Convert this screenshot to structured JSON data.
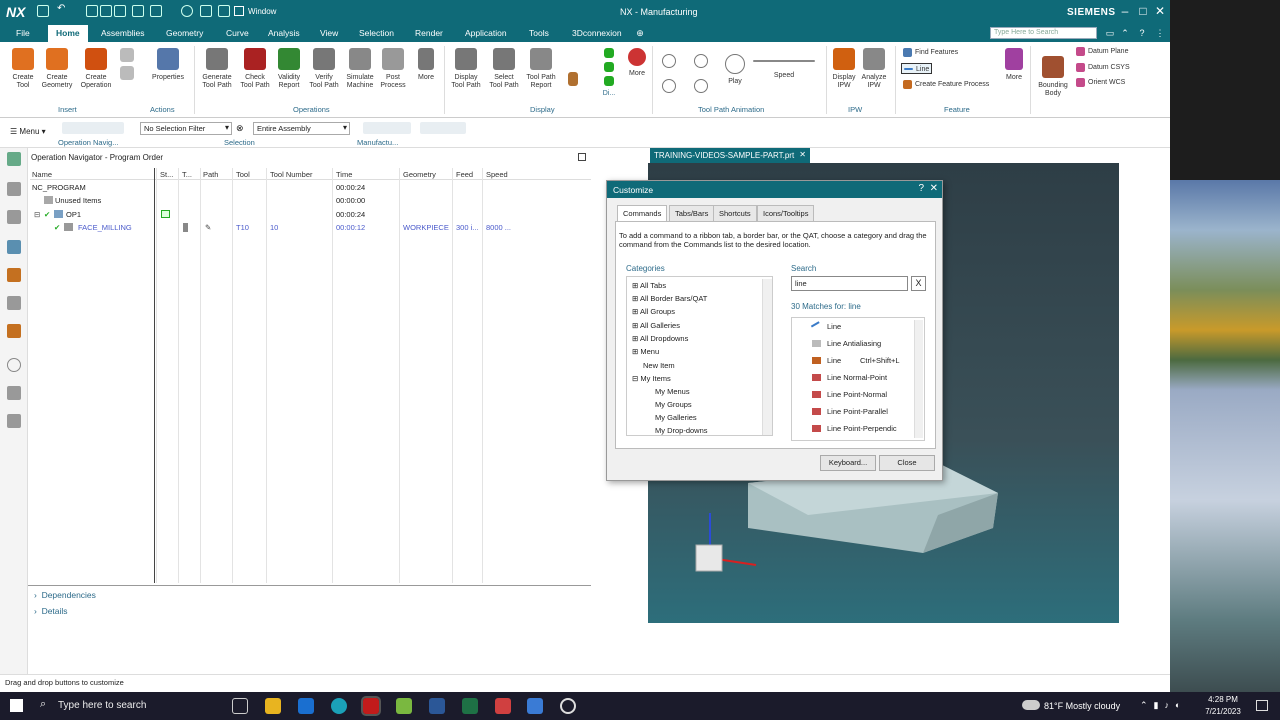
{
  "app": {
    "logo": "NX",
    "window_menu": "Window",
    "title": "NX - Manufacturing",
    "brand": "SIEMENS",
    "search_placeholder": "Type Here to Search"
  },
  "menu_tabs": [
    "File",
    "Home",
    "Assemblies",
    "Geometry",
    "Curve",
    "Analysis",
    "View",
    "Selection",
    "Render",
    "Application",
    "Tools",
    "3Dconnexion"
  ],
  "ribbon": {
    "buttons": [
      {
        "label": "Create\nTool",
        "icon": "create-tool-icon",
        "color": "#e07020"
      },
      {
        "label": "Create\nGeometry",
        "icon": "create-geometry-icon",
        "color": "#e07020"
      },
      {
        "label": "Create\nOperation",
        "icon": "create-operation-icon",
        "color": "#d05010"
      },
      {
        "label": "Properties",
        "icon": "properties-icon",
        "color": "#5577aa"
      },
      {
        "label": "Generate\nTool Path",
        "icon": "generate-tool-path-icon",
        "color": "#666"
      },
      {
        "label": "Check\nTool Path",
        "icon": "check-tool-path-icon",
        "color": "#aa2222"
      },
      {
        "label": "Validity\nReport",
        "icon": "validity-report-icon",
        "color": "#338833"
      },
      {
        "label": "Verify\nTool Path",
        "icon": "verify-tool-path-icon",
        "color": "#777"
      },
      {
        "label": "Simulate\nMachine",
        "icon": "simulate-machine-icon",
        "color": "#888"
      },
      {
        "label": "Post\nProcess",
        "icon": "post-process-icon",
        "color": "#999"
      },
      {
        "label": "More",
        "icon": "more-icon",
        "color": "#777"
      },
      {
        "label": "Display\nTool Path",
        "icon": "display-tool-path-icon",
        "color": "#777"
      },
      {
        "label": "Select\nTool Path",
        "icon": "select-tool-path-icon",
        "color": "#777"
      },
      {
        "label": "Tool Path\nReport",
        "icon": "tool-path-report-icon",
        "color": "#888"
      },
      {
        "label": "More",
        "icon": "more-icon",
        "color": "#777"
      },
      {
        "label": "Play",
        "icon": "play-icon",
        "color": "#777"
      },
      {
        "label": "Speed",
        "icon": "speed-slider-icon",
        "color": "#2a6"
      },
      {
        "label": "Display\nIPW",
        "icon": "display-ipw-icon",
        "color": "#d06010"
      },
      {
        "label": "Analyze\nIPW",
        "icon": "analyze-ipw-icon",
        "color": "#888"
      },
      {
        "label": "More",
        "icon": "more-icon",
        "color": "#a040a0"
      },
      {
        "label": "Bounding\nBody",
        "icon": "bounding-body-icon",
        "color": "#a05030"
      }
    ],
    "feature_rows": [
      "Find Features",
      "Line",
      "Create Feature Process"
    ],
    "datum_rows": [
      "Datum Plane",
      "Datum CSYS",
      "Orient WCS"
    ],
    "display_label": "Di...",
    "groups": [
      "Insert",
      "Actions",
      "Operations",
      "Display",
      "Tool Path Animation",
      "IPW",
      "Feature"
    ]
  },
  "secondary": {
    "menu": "Menu",
    "filter": "No Selection Filter",
    "scope": "Entire Assembly",
    "groups": [
      "Operation Navig...",
      "Selection",
      "Manufactu..."
    ]
  },
  "navigator": {
    "title": "Operation Navigator - Program Order",
    "columns": [
      "Name",
      "St...",
      "T...",
      "Path",
      "Tool",
      "Tool Number",
      "Time",
      "Geometry",
      "Feed",
      "Speed"
    ],
    "rows": [
      {
        "name": "NC_PROGRAM",
        "time": "00:00:24"
      },
      {
        "name": "Unused Items",
        "time": "00:00:00"
      },
      {
        "name": "OP1",
        "time": "00:00:24"
      },
      {
        "name": "FACE_MILLING",
        "tool": "T10",
        "tool_number": "10",
        "time": "00:00:12",
        "geometry": "WORKPIECE",
        "feed": "300 i...",
        "speed": "8000 ..."
      }
    ],
    "expanders": [
      "Dependencies",
      "Details"
    ]
  },
  "part_tab": "TRAINING-VIDEOS-SAMPLE-PART.prt",
  "dialog": {
    "title": "Customize",
    "tabs": [
      "Commands",
      "Tabs/Bars",
      "Shortcuts",
      "Icons/Tooltips"
    ],
    "instruction": "To add a command to a ribbon tab, a border bar, or the QAT, choose a category and drag the command from the Commands list to the desired location.",
    "categories_label": "Categories",
    "categories": [
      "All Tabs",
      "All Border Bars/QAT",
      "All Groups",
      "All Galleries",
      "All Dropdowns",
      "Menu",
      "New Item",
      "My Items",
      "My Menus",
      "My Groups",
      "My Galleries",
      "My Drop-downs"
    ],
    "search_label": "Search",
    "search_value": "line",
    "matches_label": "30 Matches for: line",
    "matches": [
      {
        "label": "Line",
        "shortcut": ""
      },
      {
        "label": "Line Antialiasing",
        "shortcut": ""
      },
      {
        "label": "Line",
        "shortcut": "Ctrl+Shift+L"
      },
      {
        "label": "Line Normal-Point",
        "shortcut": ""
      },
      {
        "label": "Line Point-Normal",
        "shortcut": ""
      },
      {
        "label": "Line Point-Parallel",
        "shortcut": ""
      },
      {
        "label": "Line Point-Perpendic",
        "shortcut": ""
      }
    ],
    "keyboard_button": "Keyboard...",
    "close_button": "Close"
  },
  "status_text": "Drag and drop buttons to customize",
  "taskbar": {
    "search": "Type here to search",
    "weather": "81°F  Mostly cloudy",
    "time": "4:28 PM",
    "date": "7/21/2023"
  },
  "colors": {
    "accent": "#0f6a78",
    "link": "#2d6b8a",
    "op_text": "#4a5acb"
  }
}
